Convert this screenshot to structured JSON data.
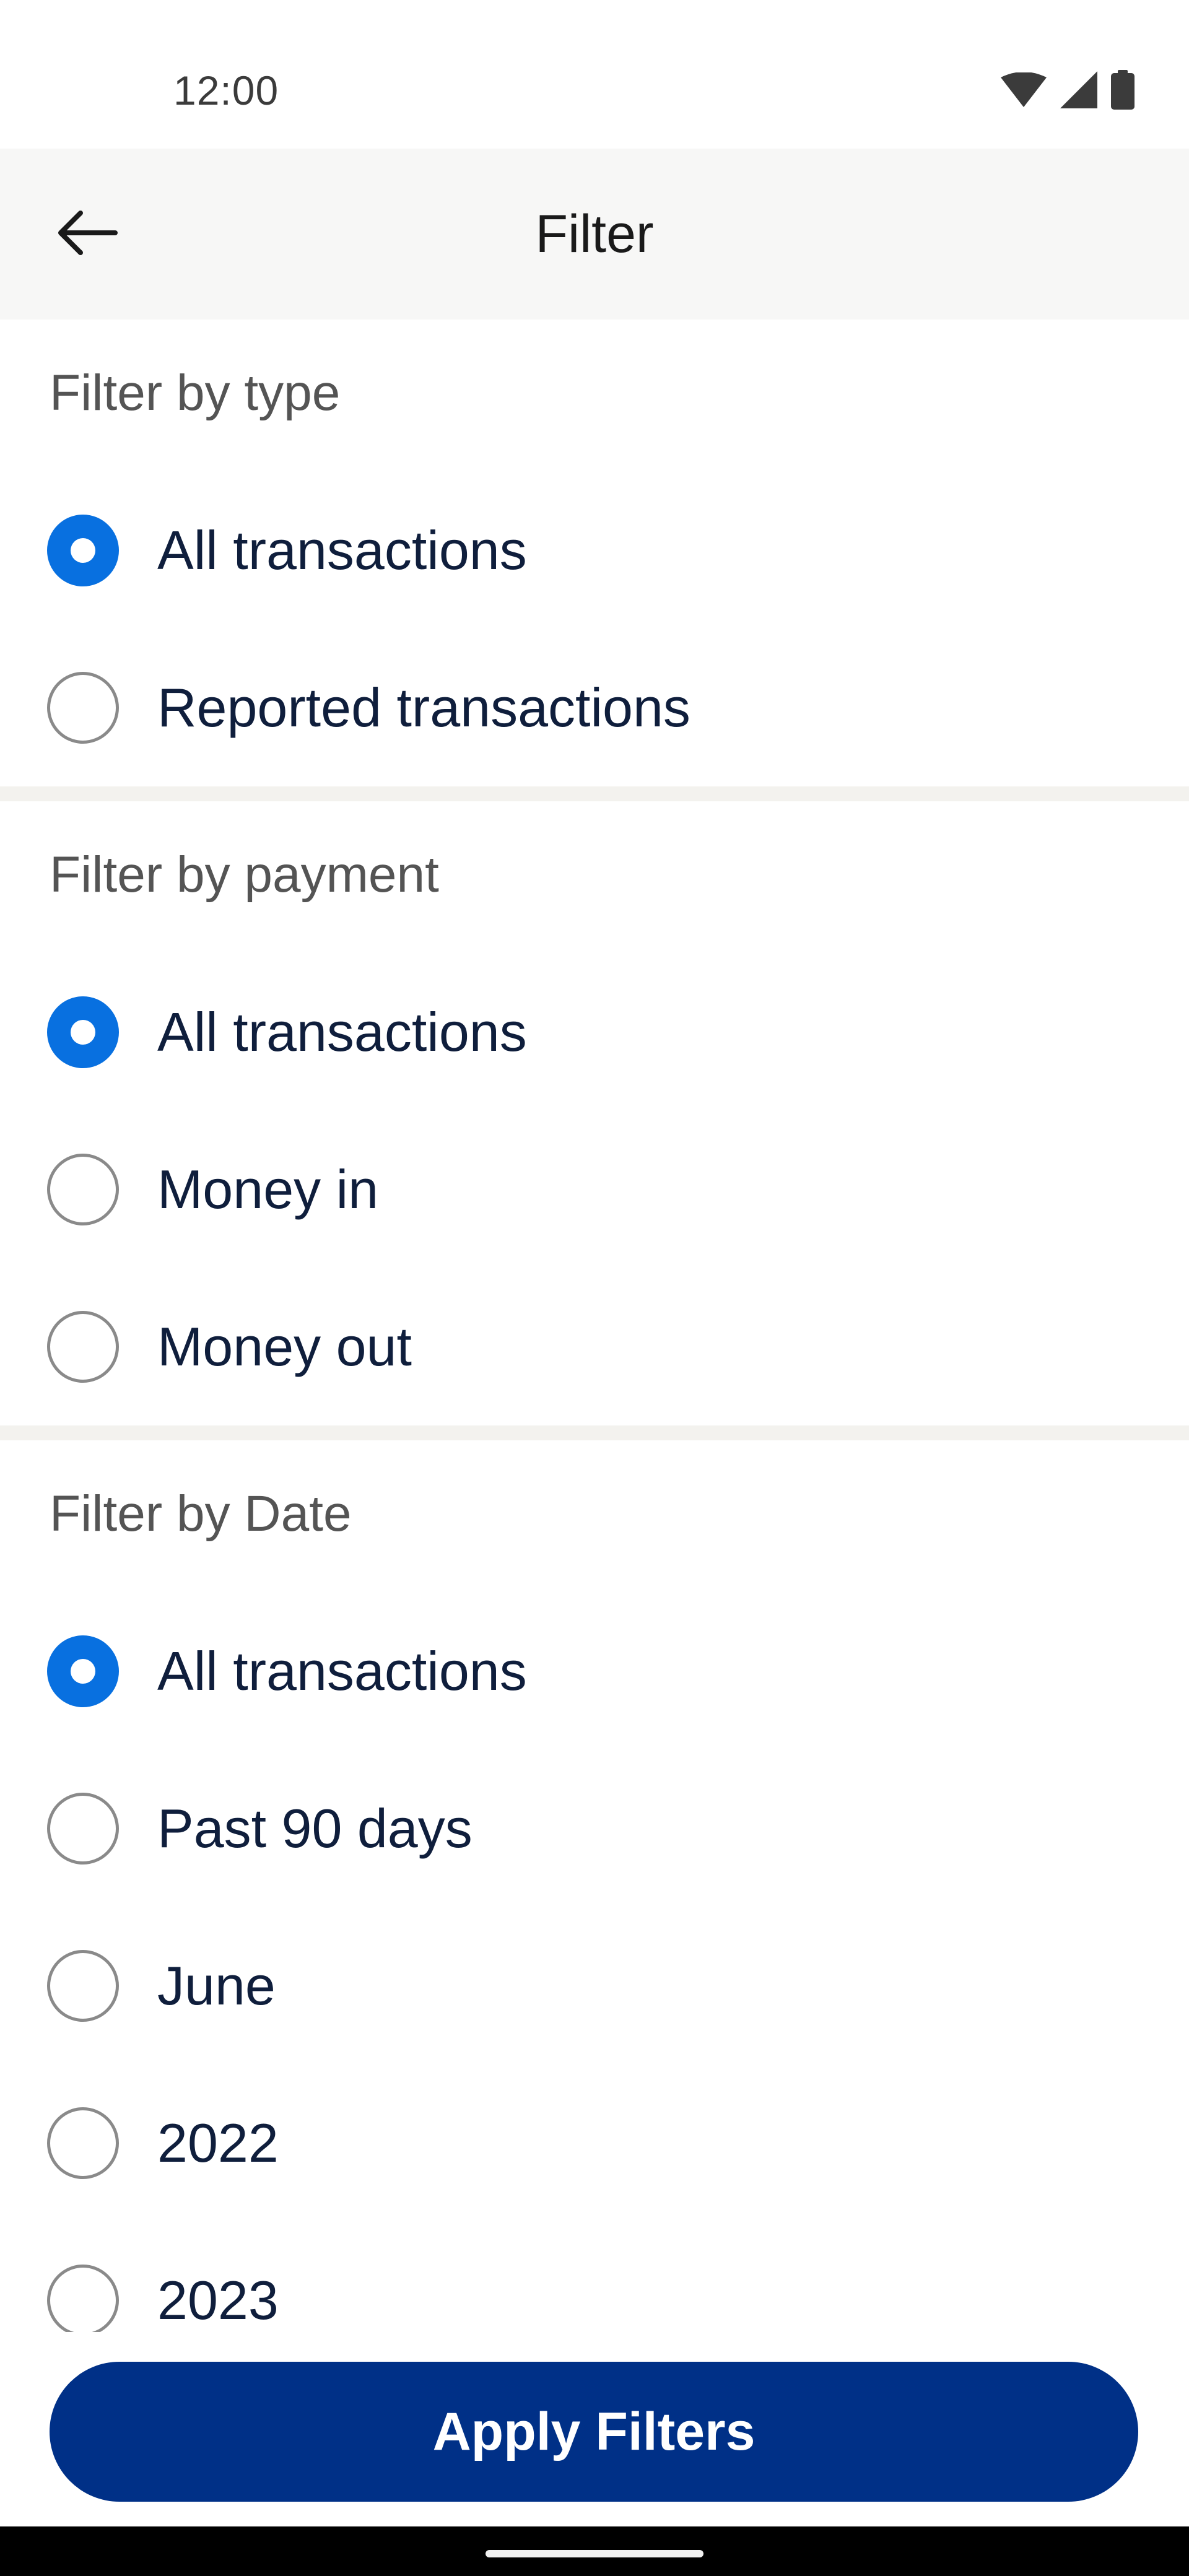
{
  "status_bar": {
    "time": "12:00",
    "icons": [
      "wifi-icon",
      "cellular-signal-icon",
      "battery-icon"
    ]
  },
  "app_bar": {
    "back_icon": "arrow-left-icon",
    "title": "Filter"
  },
  "filters": {
    "type": {
      "title": "Filter by type",
      "options": [
        {
          "label": "All transactions",
          "selected": true
        },
        {
          "label": "Reported transactions",
          "selected": false
        }
      ]
    },
    "payment": {
      "title": "Filter by payment",
      "options": [
        {
          "label": "All transactions",
          "selected": true
        },
        {
          "label": "Money in",
          "selected": false
        },
        {
          "label": "Money out",
          "selected": false
        }
      ]
    },
    "date": {
      "title": "Filter by Date",
      "options": [
        {
          "label": "All transactions",
          "selected": true
        },
        {
          "label": "Past 90 days",
          "selected": false
        },
        {
          "label": "June",
          "selected": false
        },
        {
          "label": "2022",
          "selected": false
        },
        {
          "label": "2023",
          "selected": false
        }
      ]
    }
  },
  "apply_button": {
    "label": "Apply Filters"
  },
  "colors": {
    "accent": "#0870e0",
    "button": "#003087",
    "text": "#0f1e3c",
    "header_bg": "#f7f7f6"
  }
}
